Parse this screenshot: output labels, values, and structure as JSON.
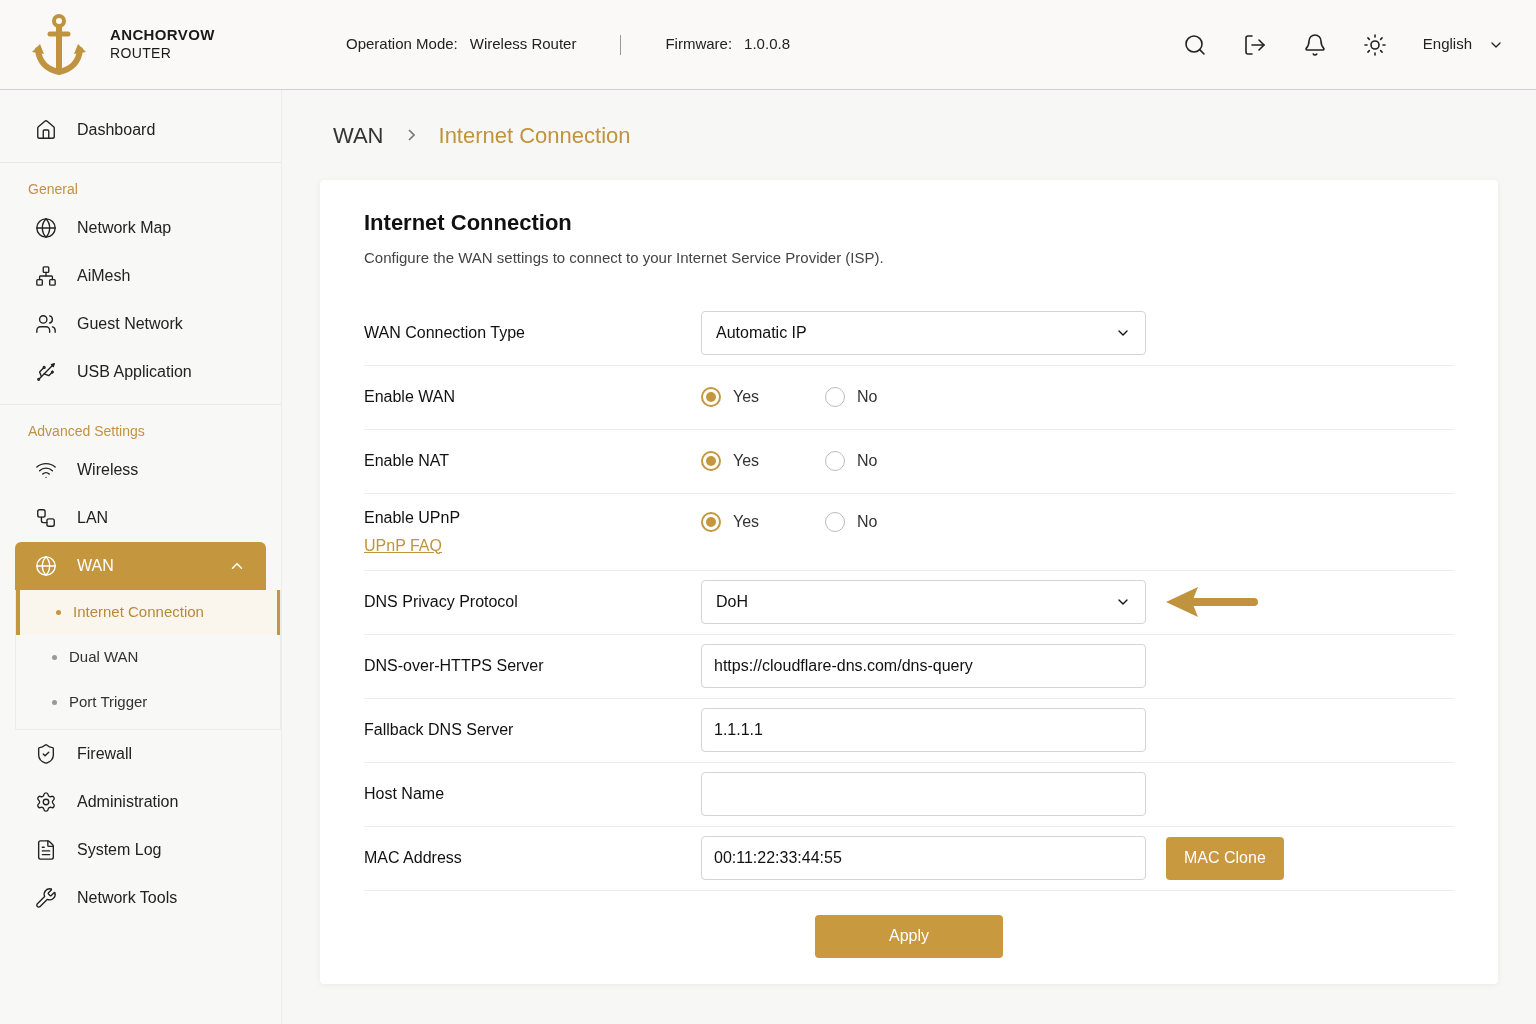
{
  "header": {
    "brand": "ANCHORVOW",
    "brand_sub": "ROUTER",
    "mode_label": "Operation Mode:",
    "mode": "Wireless Router",
    "firmware_label": "Firmware:",
    "firmware": "1.0.0.8",
    "language": "English"
  },
  "sidebar": [
    {
      "items": [
        {
          "label": "Dashboard",
          "selected": false
        }
      ]
    },
    {
      "heading": "General",
      "items": [
        {
          "label": "Network Map",
          "selected": false
        },
        {
          "label": "AiMesh",
          "selected": false
        },
        {
          "label": "Guest Network",
          "selected": false
        },
        {
          "label": "USB Application",
          "selected": false
        }
      ]
    },
    {
      "heading": "Advanced Settings",
      "items": [
        {
          "label": "Wireless",
          "selected": false
        },
        {
          "label": "LAN",
          "selected": false
        },
        {
          "label": "WAN",
          "selected": true,
          "expanded": true,
          "children": [
            {
              "label": "Internet Connection",
              "selected": true
            },
            {
              "label": "Dual WAN",
              "selected": false
            },
            {
              "label": "Port Trigger",
              "selected": false
            }
          ]
        },
        {
          "label": "Firewall",
          "selected": false
        },
        {
          "label": "Administration",
          "selected": false
        },
        {
          "label": "System Log",
          "selected": false
        },
        {
          "label": "Network Tools",
          "selected": false
        }
      ]
    }
  ],
  "breadcrumb": [
    "WAN",
    "Internet Connection"
  ],
  "card": {
    "title": "Internet Connection",
    "description": "Configure the WAN settings to connect to your Internet Service Provider (ISP).",
    "rows": [
      {
        "kind": "select",
        "label": "WAN Connection Type",
        "value": "Automatic IP"
      },
      {
        "kind": "radio",
        "label": "Enable WAN",
        "options": [
          {
            "label": "Yes",
            "selected": true
          },
          {
            "label": "No",
            "selected": false
          }
        ]
      },
      {
        "kind": "radio",
        "label": "Enable NAT",
        "options": [
          {
            "label": "Yes",
            "selected": true
          },
          {
            "label": "No",
            "selected": false
          }
        ]
      },
      {
        "kind": "radio",
        "label": "Enable UPnP",
        "link": "UPnP FAQ",
        "options": [
          {
            "label": "Yes",
            "selected": true
          },
          {
            "label": "No",
            "selected": false
          }
        ]
      },
      {
        "kind": "select",
        "label": "DNS Privacy Protocol",
        "value": "DoH",
        "pointer_arrow": true
      },
      {
        "kind": "text",
        "label": "DNS-over-HTTPS Server",
        "value": "https://cloudflare-dns.com/dns-query"
      },
      {
        "kind": "text",
        "label": "Fallback DNS Server",
        "value": "1.1.1.1"
      },
      {
        "kind": "text",
        "label": "Host Name"
      },
      {
        "kind": "text",
        "label": "MAC Address",
        "value": "00:11:22:33:44:55",
        "button": "MAC Clone"
      }
    ],
    "apply": "Apply"
  }
}
